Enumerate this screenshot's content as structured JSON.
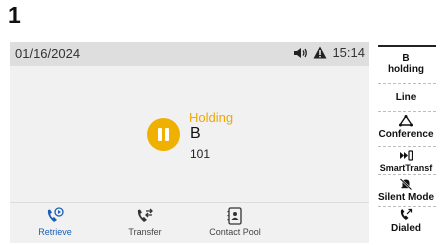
{
  "step": "1",
  "screen": {
    "date": "01/16/2024",
    "time": "15:14",
    "call": {
      "status": "Holding",
      "name": "B",
      "number": "101"
    },
    "softkeys": [
      {
        "label": "Retrieve",
        "icon": "retrieve-call-icon"
      },
      {
        "label": "Transfer",
        "icon": "transfer-call-icon"
      },
      {
        "label": "Contact Pool",
        "icon": "contact-book-icon"
      }
    ]
  },
  "linekeys": [
    {
      "line1": "B",
      "line2": "holding"
    },
    {
      "label": "Line"
    },
    {
      "label": "Conference",
      "icon": "conference-icon"
    },
    {
      "label": "SmartTransf",
      "icon": "smart-transfer-icon"
    },
    {
      "label": "Silent Mode",
      "icon": "silent-bell-icon"
    },
    {
      "label": "Dialed",
      "icon": "dialed-call-icon"
    }
  ],
  "colors": {
    "hold_accent": "#f0b000",
    "active_softkey": "#1a5fb4",
    "status_bar": "#dedede",
    "screen_bg": "#f1f1f1"
  }
}
